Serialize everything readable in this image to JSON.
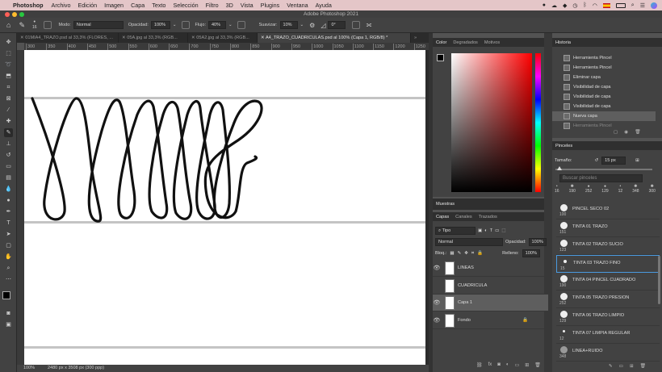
{
  "menubar": {
    "app": "Photoshop",
    "items": [
      "Archivo",
      "Edición",
      "Imagen",
      "Capa",
      "Texto",
      "Selección",
      "Filtro",
      "3D",
      "Vista",
      "Plugins",
      "Ventana",
      "Ayuda"
    ]
  },
  "window_title": "Adobe Photoshop 2021",
  "options": {
    "brush_size": "16",
    "mode_label": "Modo:",
    "mode_value": "Normal",
    "opacity_label": "Opacidad:",
    "opacity_value": "100%",
    "flow_label": "Flujo:",
    "flow_value": "40%",
    "smooth_label": "Suavizar:",
    "smooth_value": "10%",
    "angle_value": "0°"
  },
  "doc_tabs": [
    {
      "label": "01MIA4_TRAZO.psd al 33,3% (FLORES, ..."
    },
    {
      "label": "05A.jpg al 33,3% (RGB..."
    },
    {
      "label": "05A2.jpg al 33,3% (RGB..."
    },
    {
      "label": "A4_TRAZO_CUADRICULAS.psd al 100% (Capa 1, RGB/8) *",
      "active": true
    }
  ],
  "ruler_ticks": [
    "300",
    "350",
    "400",
    "450",
    "500",
    "550",
    "600",
    "650",
    "700",
    "750",
    "800",
    "850",
    "900",
    "950",
    "1000",
    "1050",
    "1100",
    "1150",
    "1200",
    "1250"
  ],
  "status": {
    "zoom": "100%",
    "doc_info": "2480 px x 3508 px (300 ppp)"
  },
  "color_panel": {
    "tabs": [
      "Color",
      "Degradados",
      "Motivos"
    ],
    "fg_color": "#000000",
    "bg_color": "#ffffff"
  },
  "history_panel": {
    "title": "Historia",
    "items": [
      "Herramienta Pincel",
      "Herramienta Pincel",
      "Eliminar capa",
      "Visibilidad de capa",
      "Visibilidad de capa",
      "Visibilidad de capa",
      "Nueva capa",
      "Herramienta Pincel"
    ]
  },
  "swatches_panel": {
    "title": "Muestras"
  },
  "layers_panel": {
    "tabs": [
      "Capas",
      "Canales",
      "Trazados"
    ],
    "filter": "Tipo",
    "blend_mode": "Normal",
    "opacity_label": "Opacidad:",
    "opacity_value": "100%",
    "lock_label": "Bloq.:",
    "fill_label": "Relleno:",
    "fill_value": "100%",
    "layers": [
      {
        "name": "LINEAS",
        "visible": true
      },
      {
        "name": "CUADRICULA",
        "visible": false
      },
      {
        "name": "Capa 1",
        "visible": true,
        "selected": true
      },
      {
        "name": "Fondo",
        "visible": true,
        "locked": true
      }
    ]
  },
  "brushes_panel": {
    "title": "Pinceles",
    "size_label": "Tamaño:",
    "size_value": "15 px",
    "search_placeholder": "Buscar pinceles",
    "recent_sizes": [
      "16",
      "190",
      "252",
      "129",
      "12",
      "348",
      "300"
    ],
    "brushes": [
      {
        "name": "PINCEL SECO 02",
        "size": "100"
      },
      {
        "name": "TINTA 01 TRAZO",
        "size": "151"
      },
      {
        "name": "TINTA 02 TRAZO SUCIO",
        "size": "123"
      },
      {
        "name": "TINTA 03 TRAZO FINO",
        "size": "15",
        "selected": true
      },
      {
        "name": "TINTA 04 PINCEL CUADRADO",
        "size": "190"
      },
      {
        "name": "TINTA 05 TRAZO PRESION",
        "size": "252"
      },
      {
        "name": "TINTA 06 TRAZO LIMPIO",
        "size": "129"
      },
      {
        "name": "TINTA 07 LIMPIA REGULAR",
        "size": "12"
      },
      {
        "name": "LINEA+RUIDO",
        "size": "348"
      }
    ]
  }
}
